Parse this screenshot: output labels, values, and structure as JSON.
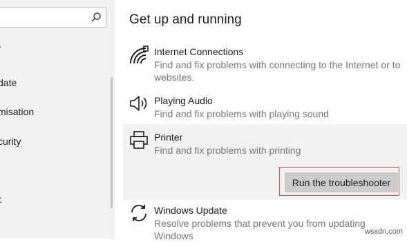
{
  "nav": {
    "items": [
      "y",
      "date",
      "misation",
      "curity",
      ":"
    ]
  },
  "main": {
    "title": "Get up and running",
    "items": [
      {
        "title": "Internet Connections",
        "desc": "Find and fix problems with connecting to the Internet or to websites.",
        "icon": "wifi-icon"
      },
      {
        "title": "Playing Audio",
        "desc": "Find and fix problems with playing sound",
        "icon": "speaker-icon"
      },
      {
        "title": "Printer",
        "desc": "Find and fix problems with printing",
        "icon": "printer-icon"
      },
      {
        "title": "Windows Update",
        "desc": "Resolve problems that prevent you from updating Windows",
        "icon": "sync-icon"
      }
    ],
    "run_button": "Run the troubleshooter"
  },
  "watermark": "wsxdn.com",
  "colors": {
    "accent_outline": "#d9534f",
    "selected_bg": "#f2f2f2",
    "button_bg": "#cccccc"
  }
}
